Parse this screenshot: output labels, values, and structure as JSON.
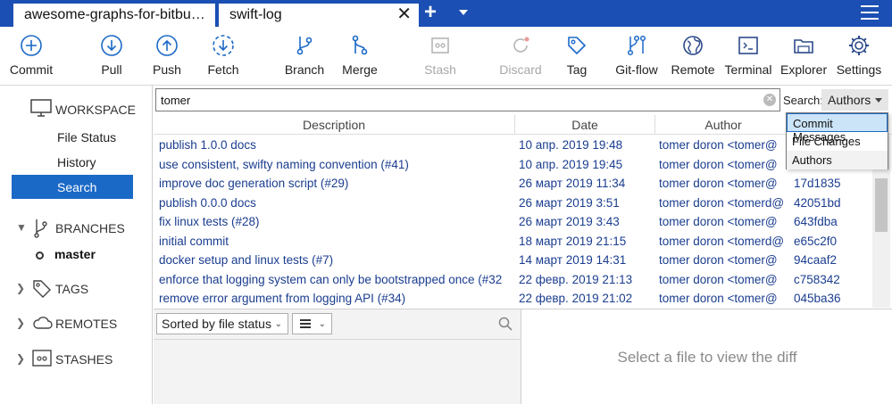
{
  "tabs": [
    {
      "label": "awesome-graphs-for-bitbu…"
    },
    {
      "label": "swift-log"
    }
  ],
  "toolbar": {
    "commit": "Commit",
    "pull": "Pull",
    "push": "Push",
    "fetch": "Fetch",
    "branch": "Branch",
    "merge": "Merge",
    "stash": "Stash",
    "discard": "Discard",
    "tag": "Tag",
    "gitflow": "Git-flow",
    "remote": "Remote",
    "terminal": "Terminal",
    "explorer": "Explorer",
    "settings": "Settings"
  },
  "sidebar": {
    "workspace": "WORKSPACE",
    "items": [
      "File Status",
      "History",
      "Search"
    ],
    "branches": "BRANCHES",
    "branch_master": "master",
    "tags": "TAGS",
    "remotes": "REMOTES",
    "stashes": "STASHES"
  },
  "search": {
    "value": "tomer",
    "label": "Search:",
    "mode": "Authors",
    "options": [
      "Commit Messages",
      "File Changes",
      "Authors"
    ]
  },
  "table": {
    "headers": [
      "Description",
      "Date",
      "Author"
    ],
    "rows": [
      {
        "desc": "publish 1.0.0 docs",
        "date": "10 апр. 2019 19:48",
        "author": "tomer doron <tomer@",
        "hash": ""
      },
      {
        "desc": "use consistent, swifty naming convention (#41)",
        "date": "10 апр. 2019 19:45",
        "author": "tomer doron <tomer@",
        "hash": ""
      },
      {
        "desc": "improve doc generation script (#29)",
        "date": "26 март 2019 11:34",
        "author": "tomer doron <tomer@",
        "hash": "17d1835"
      },
      {
        "desc": "publish 0.0.0 docs",
        "date": "26 март 2019 3:51",
        "author": "tomer doron <tomerd@",
        "hash": "42051bd"
      },
      {
        "desc": "fix linux tests (#28)",
        "date": "26 март 2019 3:43",
        "author": "tomer doron <tomer@",
        "hash": "643fdba"
      },
      {
        "desc": "initial commit",
        "date": "18 март 2019 21:15",
        "author": "tomer doron <tomerd@",
        "hash": "e65c2f0"
      },
      {
        "desc": "docker setup and linux tests (#7)",
        "date": "14 март 2019 14:31",
        "author": "tomer doron <tomer@",
        "hash": "94caaf2"
      },
      {
        "desc": "enforce that logging system can only be bootstrapped once (#32",
        "date": "22 февр. 2019 21:13",
        "author": "tomer doron <tomer@",
        "hash": "c758342"
      },
      {
        "desc": "remove error argument from logging API (#34)",
        "date": "22 февр. 2019 21:02",
        "author": "tomer doron <tomer@",
        "hash": "045ba36"
      }
    ]
  },
  "files": {
    "sort_label": "Sorted by file status"
  },
  "diff": {
    "placeholder": "Select a file to view the diff"
  },
  "colors": {
    "accent": "#1b4fb3",
    "selection": "#1b69c7",
    "link_text": "#1a3d8f"
  }
}
